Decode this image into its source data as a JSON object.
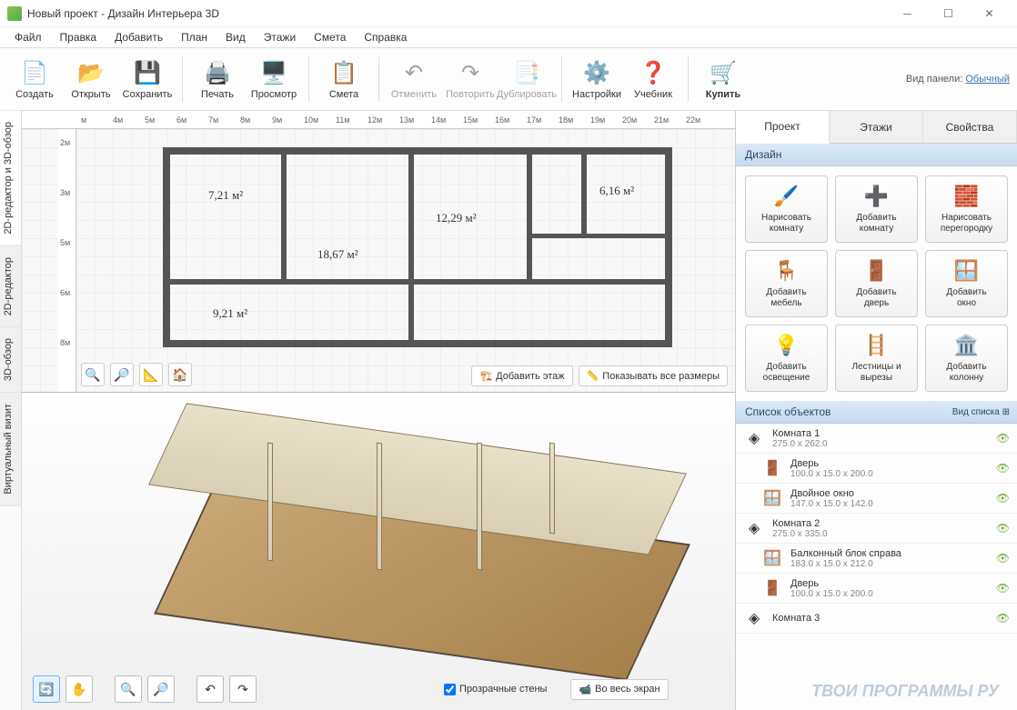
{
  "window": {
    "title": "Новый проект - Дизайн Интерьера 3D"
  },
  "menu": [
    "Файл",
    "Правка",
    "Добавить",
    "План",
    "Вид",
    "Этажи",
    "Смета",
    "Справка"
  ],
  "toolbar": {
    "create": "Создать",
    "open": "Открыть",
    "save": "Сохранить",
    "print": "Печать",
    "preview": "Просмотр",
    "estimate": "Смета",
    "undo": "Отменить",
    "redo": "Повторить",
    "duplicate": "Дублировать",
    "settings": "Настройки",
    "tutorial": "Учебник",
    "buy": "Купить",
    "panel_label": "Вид панели:",
    "panel_link": "Обычный"
  },
  "side_tabs": {
    "t1": "2D-редактор и 3D-обзор",
    "t2": "2D-редактор",
    "t3": "3D-обзор",
    "t4": "Виртуальный визит"
  },
  "ruler": {
    "h": [
      "м",
      "4м",
      "5м",
      "6м",
      "7м",
      "8м",
      "9м",
      "10м",
      "11м",
      "12м",
      "13м",
      "14м",
      "15м",
      "16м",
      "17м",
      "18м",
      "19м",
      "20м",
      "21м",
      "22м"
    ],
    "v": [
      "2м",
      "3м",
      "5м",
      "6м",
      "8м"
    ]
  },
  "rooms": {
    "r1": "7,21 м²",
    "r2": "18,67 м²",
    "r3": "12,29 м²",
    "r4": "6,16 м²",
    "r5": "9,21 м²"
  },
  "plan_buttons": {
    "add_floor": "Добавить этаж",
    "show_dims": "Показывать все размеры"
  },
  "view3d_controls": {
    "transparent": "Прозрачные стены",
    "fullscreen": "Во весь экран"
  },
  "right_tabs": {
    "project": "Проект",
    "floors": "Этажи",
    "props": "Свойства"
  },
  "design_section": "Дизайн",
  "design_buttons": [
    {
      "icon": "🖌️",
      "l1": "Нарисовать",
      "l2": "комнату"
    },
    {
      "icon": "➕",
      "l1": "Добавить",
      "l2": "комнату"
    },
    {
      "icon": "🧱",
      "l1": "Нарисовать",
      "l2": "перегородку"
    },
    {
      "icon": "🪑",
      "l1": "Добавить",
      "l2": "мебель"
    },
    {
      "icon": "🚪",
      "l1": "Добавить",
      "l2": "дверь"
    },
    {
      "icon": "🪟",
      "l1": "Добавить",
      "l2": "окно"
    },
    {
      "icon": "💡",
      "l1": "Добавить",
      "l2": "освещение"
    },
    {
      "icon": "🪜",
      "l1": "Лестницы и",
      "l2": "вырезы"
    },
    {
      "icon": "🏛️",
      "l1": "Добавить",
      "l2": "колонну"
    }
  ],
  "objects_section": "Список объектов",
  "list_view_label": "Вид списка",
  "objects": [
    {
      "icon": "◈",
      "name": "Комната 1",
      "dims": "275.0 x 262.0",
      "child": false
    },
    {
      "icon": "🚪",
      "name": "Дверь",
      "dims": "100.0 x 15.0 x 200.0",
      "child": true
    },
    {
      "icon": "🪟",
      "name": "Двойное окно",
      "dims": "147.0 x 15.0 x 142.0",
      "child": true
    },
    {
      "icon": "◈",
      "name": "Комната 2",
      "dims": "275.0 x 335.0",
      "child": false
    },
    {
      "icon": "🪟",
      "name": "Балконный блок справа",
      "dims": "183.0 x 15.0 x 212.0",
      "child": true
    },
    {
      "icon": "🚪",
      "name": "Дверь",
      "dims": "100.0 x 15.0 x 200.0",
      "child": true
    },
    {
      "icon": "◈",
      "name": "Комната 3",
      "dims": "",
      "child": false
    }
  ],
  "watermark": "ТВОИ ПРОГРАММЫ РУ"
}
